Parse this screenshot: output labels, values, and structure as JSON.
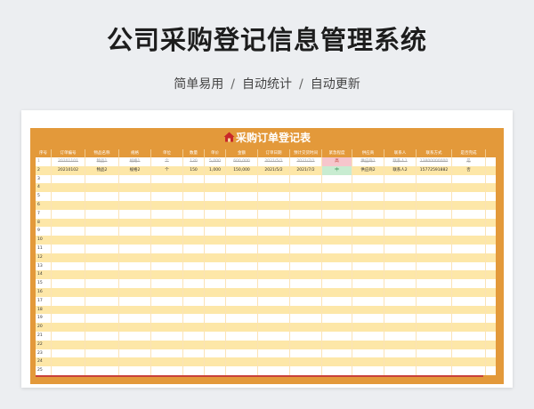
{
  "hero": {
    "title": "公司采购登记信息管理系统",
    "features": [
      "简单易用",
      "自动统计",
      "自动更新"
    ],
    "separator": "/"
  },
  "sheet": {
    "title": "采购订单登记表",
    "icon": "house-icon",
    "accent_color": "#e3993a",
    "headers": [
      "序号",
      "订单编号",
      "物品名称",
      "规格",
      "单位",
      "数量",
      "单价",
      "金额",
      "订单日期",
      "预计交货时间",
      "紧急程度",
      "供应商",
      "联系人",
      "联系方式",
      "是否完成"
    ],
    "rows": [
      {
        "idx": "1",
        "order_no": "20201101",
        "item": "物品1",
        "spec": "规格1",
        "unit": "个",
        "qty": "120",
        "price": "5,000",
        "amount": "600,000",
        "order_date": "2021/5/1",
        "due": "2021/7/1",
        "priority": "高",
        "supplier": "供应商1",
        "contact": "联系人1",
        "phone": "13800000000",
        "done": "是"
      },
      {
        "idx": "2",
        "order_no": "20210102",
        "item": "物品2",
        "spec": "规格2",
        "unit": "个",
        "qty": "150",
        "price": "1,000",
        "amount": "150,000",
        "order_date": "2021/5/2",
        "due": "2021/7/2",
        "priority": "中",
        "supplier": "供应商2",
        "contact": "联系人2",
        "phone": "15772591882",
        "done": "否"
      },
      {
        "idx": "3"
      },
      {
        "idx": "4"
      },
      {
        "idx": "5"
      },
      {
        "idx": "6"
      },
      {
        "idx": "7"
      },
      {
        "idx": "8"
      },
      {
        "idx": "9"
      },
      {
        "idx": "10"
      },
      {
        "idx": "11"
      },
      {
        "idx": "12"
      },
      {
        "idx": "13"
      },
      {
        "idx": "14"
      },
      {
        "idx": "15"
      },
      {
        "idx": "16"
      },
      {
        "idx": "17"
      },
      {
        "idx": "18"
      },
      {
        "idx": "19"
      },
      {
        "idx": "20"
      },
      {
        "idx": "21"
      },
      {
        "idx": "22"
      },
      {
        "idx": "23"
      },
      {
        "idx": "24"
      },
      {
        "idx": "25"
      }
    ]
  }
}
